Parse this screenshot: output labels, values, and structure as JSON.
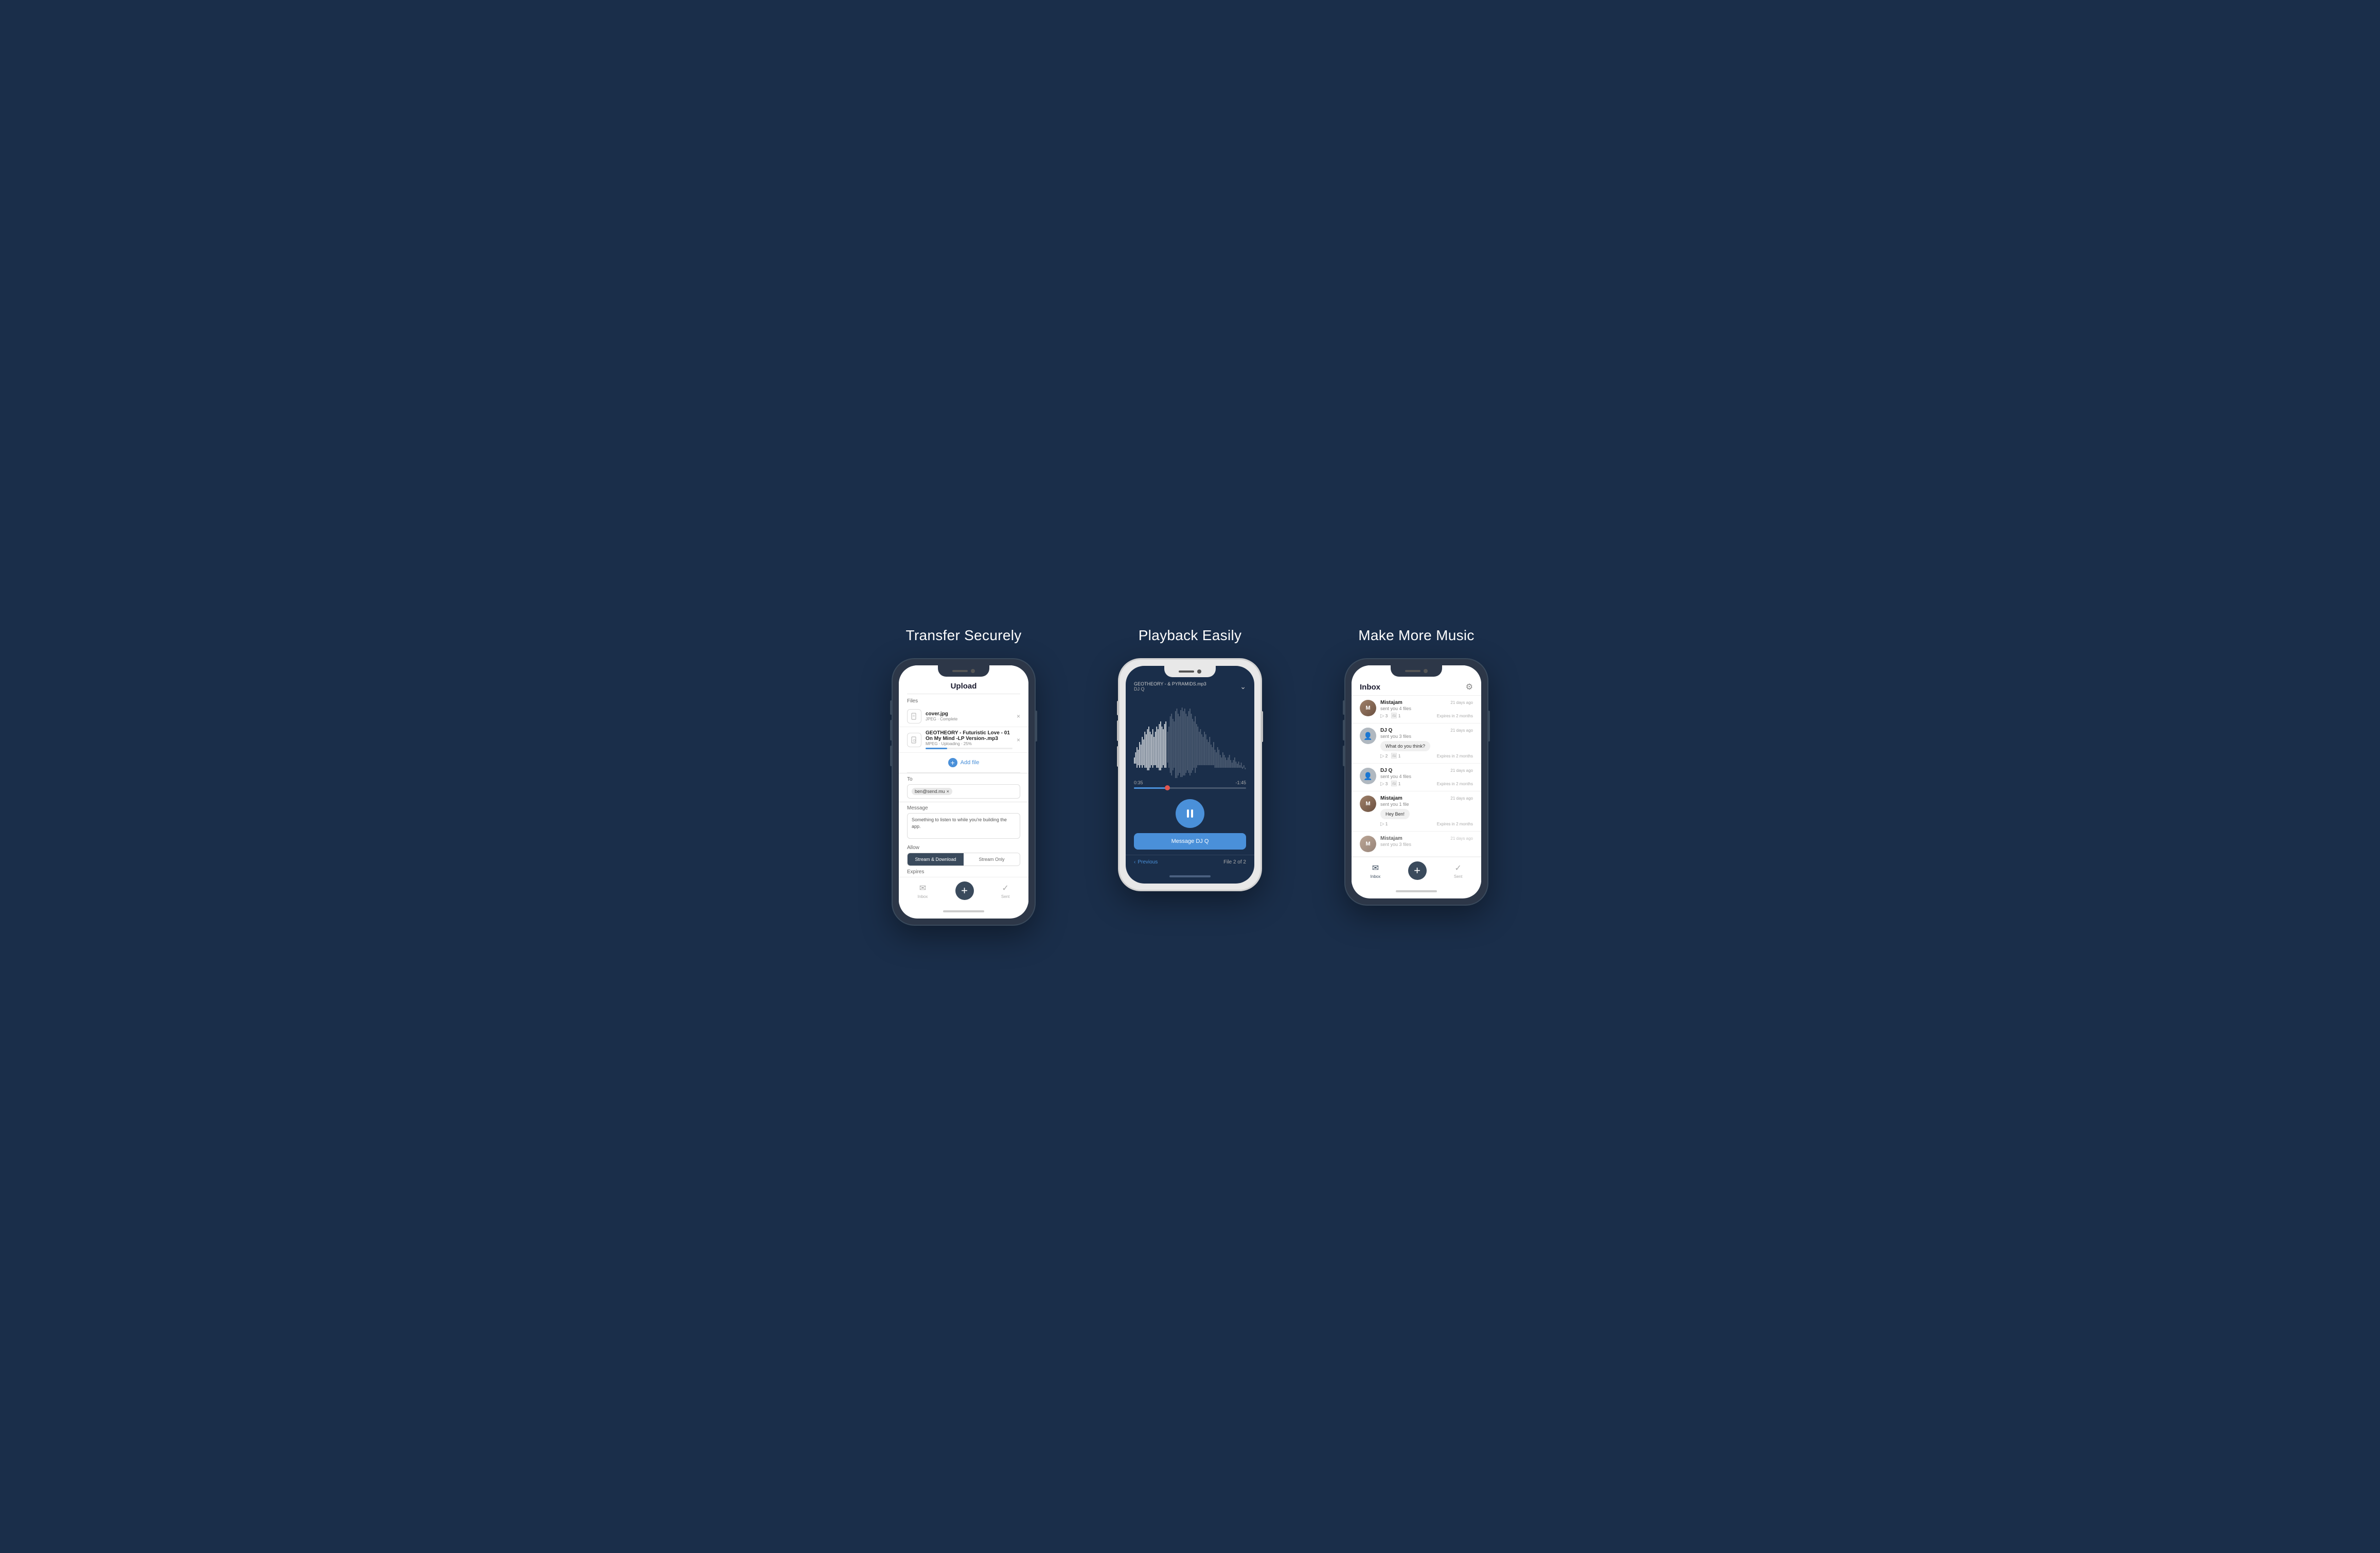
{
  "page": {
    "background": "#1a2e4a"
  },
  "sections": [
    {
      "id": "transfer",
      "title": "Transfer Securely",
      "phone": {
        "style": "dark",
        "screen": "upload",
        "header": "Upload",
        "files_label": "Files",
        "files": [
          {
            "name": "cover.jpg",
            "meta": "JPEG · Complete",
            "status": "complete"
          },
          {
            "name": "GEOTHEORY - Futuristic Love - 01 On My Mind -LP Version-.mp3",
            "meta": "MPEG · Uploading · 25%",
            "status": "uploading",
            "progress": 25
          }
        ],
        "add_file_label": "Add file",
        "to_label": "To",
        "to_value": "ben@send.mu",
        "message_label": "Message",
        "message_value": "Something to listen to while you're building the app.",
        "allow_label": "Allow",
        "allow_options": [
          "Stream & Download",
          "Stream Only"
        ],
        "allow_active": 0,
        "expires_label": "Expires",
        "nav": {
          "inbox": "Inbox",
          "sent": "Sent"
        }
      }
    },
    {
      "id": "playback",
      "title": "Playback Easily",
      "phone": {
        "style": "white",
        "screen": "playback",
        "track": {
          "filename": "& PYRAMIDS.mp3",
          "artist": "DJ Q",
          "artist2": "GEOTHEORY -"
        },
        "time_current": "0:35",
        "time_remaining": "-1:45",
        "message_btn": "Message DJ Q",
        "nav": {
          "previous": "Previous",
          "file_counter": "File 2 of 2"
        }
      }
    },
    {
      "id": "inbox",
      "title": "Make More Music",
      "phone": {
        "style": "dark",
        "screen": "inbox",
        "header": "Inbox",
        "messages": [
          {
            "sender": "Mistajam",
            "avatar_type": "photo",
            "time": "21 days ago",
            "subtext": "sent you 4 files",
            "audio_count": 3,
            "image_count": 1,
            "expires": "Expires in 2 months"
          },
          {
            "sender": "DJ Q",
            "avatar_type": "placeholder",
            "time": "21 days ago",
            "subtext": "sent you 3 files",
            "bubble": "What do you think?",
            "audio_count": 2,
            "image_count": 1,
            "expires": "Expires in 2 months"
          },
          {
            "sender": "DJ Q",
            "avatar_type": "placeholder",
            "time": "21 days ago",
            "subtext": "sent you 4 files",
            "audio_count": 3,
            "image_count": 1,
            "expires": "Expires in 2 months"
          },
          {
            "sender": "Mistajam",
            "avatar_type": "photo",
            "time": "21 days ago",
            "subtext": "sent you 1 file",
            "bubble": "Hey Ben!",
            "audio_count": 1,
            "expires": "Expires in 2 months"
          },
          {
            "sender": "Mistajam",
            "avatar_type": "photo",
            "time": "21 days ago",
            "subtext": "sent you 3 files"
          }
        ],
        "nav": {
          "inbox": "Inbox",
          "sent": "Sent"
        }
      }
    }
  ]
}
